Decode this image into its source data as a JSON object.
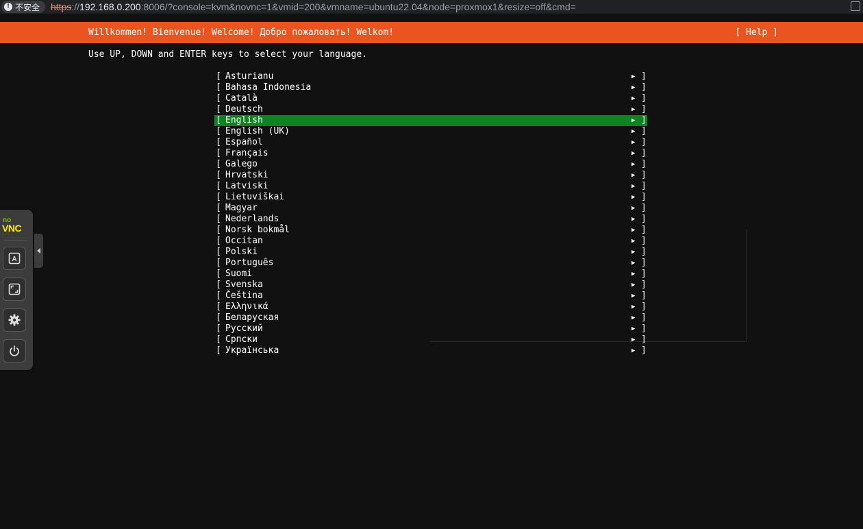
{
  "browser": {
    "security_label": "不安全",
    "url_scheme": "https",
    "url_sep": "://",
    "url_host": "192.168.0.200",
    "url_rest": ":8006/?console=kvm&novnc=1&vmid=200&vmname=ubuntu22.04&node=proxmox1&resize=off&cmd="
  },
  "installer": {
    "welcome": "Willkommen! Bienvenue! Welcome! Добро пожаловать! Welkom!",
    "help_label": "[ Help ]",
    "instructions": "Use UP, DOWN and ENTER keys to select your language.",
    "selected_index": 4,
    "header_color": "#e95420",
    "selection_color": "#0e8420",
    "languages": [
      {
        "name": "Asturianu"
      },
      {
        "name": "Bahasa Indonesia"
      },
      {
        "name": "Català"
      },
      {
        "name": "Deutsch"
      },
      {
        "name": "English"
      },
      {
        "name": "English (UK)"
      },
      {
        "name": "Español"
      },
      {
        "name": "Français"
      },
      {
        "name": "Galego"
      },
      {
        "name": "Hrvatski"
      },
      {
        "name": "Latviski"
      },
      {
        "name": "Lietuviškai"
      },
      {
        "name": "Magyar"
      },
      {
        "name": "Nederlands"
      },
      {
        "name": "Norsk bokmål"
      },
      {
        "name": "Occitan"
      },
      {
        "name": "Polski"
      },
      {
        "name": "Português"
      },
      {
        "name": "Suomi"
      },
      {
        "name": "Svenska"
      },
      {
        "name": "Čeština"
      },
      {
        "name": "Ελληνικά"
      },
      {
        "name": "Беларуская"
      },
      {
        "name": "Русский"
      },
      {
        "name": "Српски"
      },
      {
        "name": "Українська"
      }
    ],
    "item_left_bracket": "[",
    "item_right_bracket": "]",
    "item_arrow": "▶"
  },
  "novnc": {
    "logo_no": "no",
    "logo_vnc": "VNC",
    "buttons": [
      "keyboard-icon",
      "fullscreen-icon",
      "settings-icon",
      "power-icon"
    ]
  }
}
